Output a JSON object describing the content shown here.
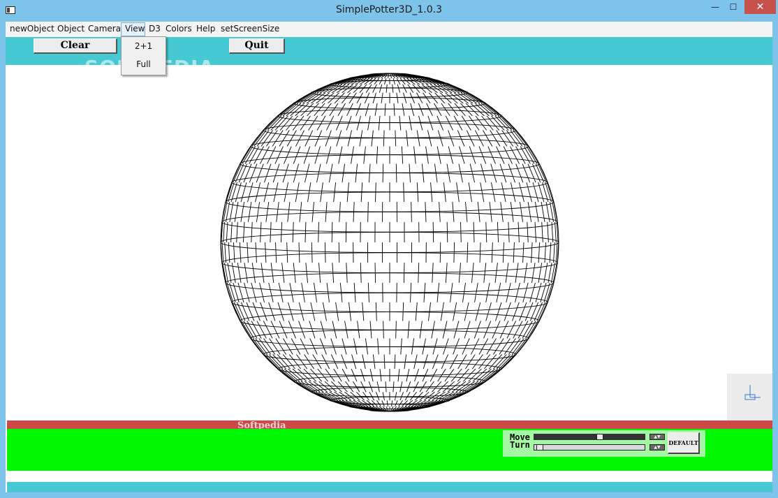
{
  "window": {
    "title": "SimplePotter3D_1.0.3",
    "minimize_glyph": "—",
    "maximize_glyph": "☐",
    "close_glyph": "✕"
  },
  "menu": {
    "items": [
      "newObject",
      "Object",
      "Camera",
      "View",
      "D3",
      "Colors",
      "Help",
      "setScreenSize"
    ],
    "active": "View",
    "dropdown": [
      "2+1",
      "Full"
    ]
  },
  "toolbar": {
    "clear_label": "Clear",
    "quit_label": "Quit"
  },
  "watermark": "SOFTPEDIA",
  "status": {
    "red_bar_text": "Softpedia"
  },
  "controls": {
    "move_label": "Move",
    "turn_label": "Turn",
    "default_label": "DEFAULT",
    "move_level": 0.6,
    "turn_level": 0.02
  },
  "colors": {
    "toolbar": "#46c9d3",
    "status_red": "#cd4848",
    "control_green": "#00f800",
    "close_red": "#c7514b"
  }
}
